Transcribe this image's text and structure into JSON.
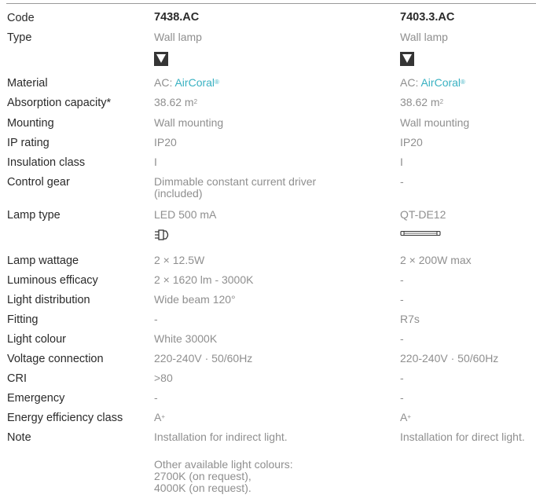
{
  "columns": [
    "7438.AC",
    "7403.3.AC"
  ],
  "rows": {
    "code": {
      "label": "Code",
      "v1": "7438.AC",
      "v2": "7403.3.AC"
    },
    "type": {
      "label": "Type",
      "v1": "Wall lamp",
      "v2": "Wall lamp"
    },
    "material": {
      "label": "Material",
      "v1_prefix": "AC: ",
      "v1_brand": "AirCoral",
      "v2_prefix": "AC: ",
      "v2_brand": "AirCoral",
      "brand_mark": "®"
    },
    "absorption": {
      "label": "Absorption capacity*",
      "v1": "38.62 m",
      "v2": "38.62 m",
      "unit_sup": "2"
    },
    "mounting": {
      "label": "Mounting",
      "v1": "Wall mounting",
      "v2": "Wall mounting"
    },
    "ip": {
      "label": "IP rating",
      "v1": "IP20",
      "v2": "IP20"
    },
    "insulation": {
      "label": "Insulation class",
      "v1": "I",
      "v2": "I"
    },
    "control": {
      "label": "Control gear",
      "v1": "Dimmable constant current driver\n(included)",
      "v2": "-"
    },
    "lamp_type": {
      "label": "Lamp type",
      "v1": "LED 500 mA",
      "v2": "QT-DE12"
    },
    "wattage": {
      "label": "Lamp wattage",
      "v1": "2 × 12.5W",
      "v2": "2 × 200W max"
    },
    "efficacy": {
      "label": "Luminous efficacy",
      "v1": "2 × 1620 lm - 3000K",
      "v2": "-"
    },
    "distribution": {
      "label": "Light distribution",
      "v1": "Wide beam 120°",
      "v2": "-"
    },
    "fitting": {
      "label": "Fitting",
      "v1": "-",
      "v2": "R7s"
    },
    "colour": {
      "label": "Light colour",
      "v1": "White 3000K",
      "v2": "-"
    },
    "voltage": {
      "label": "Voltage connection",
      "v1": "220-240V · 50/60Hz",
      "v2": "220-240V · 50/60Hz"
    },
    "cri": {
      "label": "CRI",
      "v1": ">80",
      "v2": "-"
    },
    "emergency": {
      "label": "Emergency",
      "v1": "-",
      "v2": "-"
    },
    "energy": {
      "label": "Energy efficiency class",
      "v1": "A",
      "v2": "A",
      "energy_sup": "+"
    },
    "note": {
      "label": "Note",
      "v1": "Installation for indirect light.",
      "v2": "Installation for direct light."
    },
    "note_extra": {
      "v1": "Other available light colours:\n2700K (on request),\n4000K (on request)."
    }
  },
  "icons": {
    "mount_1": "wall-mount-triangle-icon",
    "mount_2": "wall-mount-triangle-icon",
    "lamp_1": "led-plug-icon",
    "lamp_2": "linear-tube-lamp-icon"
  },
  "colors": {
    "accent": "#39b1c2",
    "label": "#2a2a2a",
    "value": "#8f8f8f",
    "icon": "#353535"
  }
}
